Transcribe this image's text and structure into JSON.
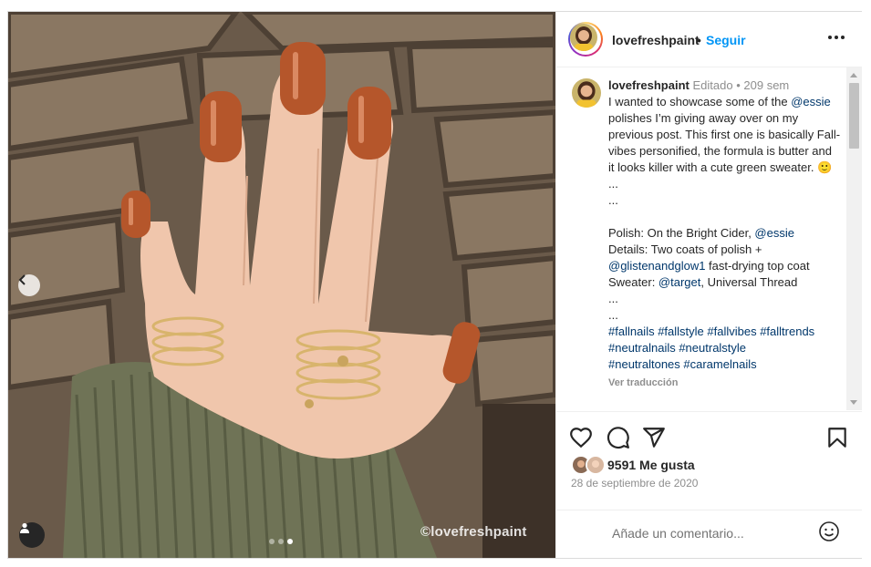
{
  "photo": {
    "watermark": "©lovefreshpaint",
    "carousel_count": 3,
    "carousel_active": 2,
    "icons": {
      "prev": "chevron-left-icon",
      "tags": "user-tag-icon"
    }
  },
  "header": {
    "username": "lovefreshpaint",
    "separator": "•",
    "follow_label": "Seguir",
    "more_icon": "more-horizontal-icon"
  },
  "caption": {
    "username": "lovefreshpaint",
    "edited": "Editado",
    "separator": "•",
    "age": "209 sem",
    "intro": "I wanted to showcase some of the",
    "mention_essie": "@essie",
    "line2": " polishes I’m giving away over on my previous post. This first one is basically Fall-vibes personified, the formula is butter and it looks killer with a cute green sweater. 🙂",
    "dots1": "...",
    "dots2": "...",
    "polish_label": "Polish: On the Bright Cider, ",
    "polish_mention": "@essie",
    "details_label": "Details: Two coats of polish + ",
    "details_mention": "@glistenandglow1",
    "details_rest": " fast-drying top coat",
    "sweater_label": "Sweater: ",
    "sweater_mention": "@target",
    "sweater_rest": ", Universal Thread",
    "dots3": "...",
    "dots4": "...",
    "hashtags_1": "#fallnails #fallstyle #fallvibes #falltrends",
    "hashtags_2": "#neutralnails #neutralstyle",
    "hashtags_3": "#neutraltones #caramelnails",
    "translate_label": "Ver traducción"
  },
  "actions": {
    "like_icon": "heart-icon",
    "comment_icon": "comment-icon",
    "share_icon": "send-icon",
    "save_icon": "bookmark-icon"
  },
  "likes": {
    "text": "9591 Me gusta"
  },
  "date": "28 de septiembre de 2020",
  "add_comment": {
    "placeholder": "Añade un comentario...",
    "emoji_icon": "emoji-icon"
  },
  "colors": {
    "link": "#00376b",
    "follow": "#0095f6",
    "polish": "#b5562b",
    "sweater": "#6f7356"
  }
}
